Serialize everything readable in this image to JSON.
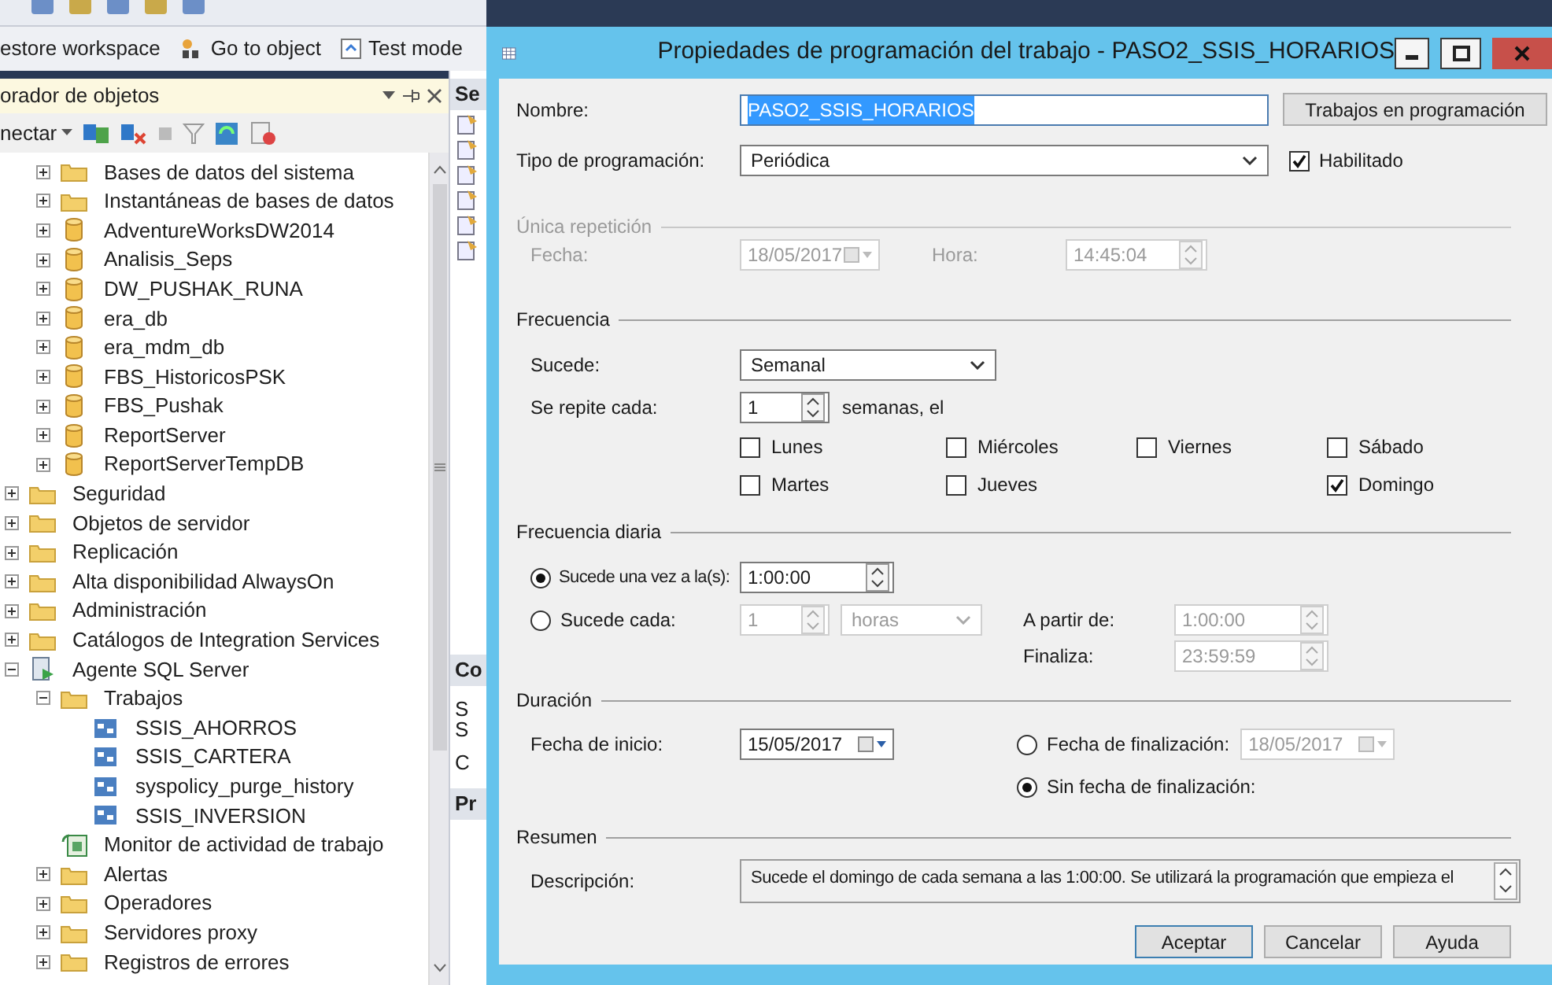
{
  "toolbar": {
    "items": [
      {
        "label": "estore workspace",
        "kind": "plain"
      },
      {
        "label": "Go to object",
        "kind": "binoculars"
      },
      {
        "label": "Test mode",
        "kind": "test"
      }
    ]
  },
  "object_explorer": {
    "title": "orador de objetos",
    "connect_label": "nectar",
    "partial_branch": [
      {
        "label": "Bases de datos del sistema",
        "kind": "folder",
        "expanded": false
      },
      {
        "label": "Instantáneas de bases de datos",
        "kind": "folder",
        "expanded": false
      },
      {
        "label": "AdventureWorksDW2014",
        "kind": "database",
        "expanded": false
      },
      {
        "label": "Analisis_Seps",
        "kind": "database",
        "expanded": false
      },
      {
        "label": "DW_PUSHAK_RUNA",
        "kind": "database",
        "expanded": false
      },
      {
        "label": "era_db",
        "kind": "database",
        "expanded": false
      },
      {
        "label": "era_mdm_db",
        "kind": "database",
        "expanded": false
      },
      {
        "label": "FBS_HistoricosPSK",
        "kind": "database",
        "expanded": false
      },
      {
        "label": "FBS_Pushak",
        "kind": "database",
        "expanded": false
      },
      {
        "label": "ReportServer",
        "kind": "database",
        "expanded": false
      },
      {
        "label": "ReportServerTempDB",
        "kind": "database",
        "expanded": false
      }
    ],
    "tree": [
      {
        "label": "Seguridad",
        "kind": "folder",
        "expanded": false
      },
      {
        "label": "Objetos de servidor",
        "kind": "folder",
        "expanded": false
      },
      {
        "label": "Replicación",
        "kind": "folder",
        "expanded": false
      },
      {
        "label": "Alta disponibilidad AlwaysOn",
        "kind": "folder",
        "expanded": false
      },
      {
        "label": "Administración",
        "kind": "folder",
        "expanded": false
      },
      {
        "label": "Catálogos de Integration Services",
        "kind": "folder",
        "expanded": false
      },
      {
        "label": "Agente SQL Server",
        "kind": "agent",
        "expanded": true,
        "children": [
          {
            "label": "Trabajos",
            "kind": "folder",
            "expanded": true,
            "children": [
              {
                "label": "SSIS_AHORROS",
                "kind": "job"
              },
              {
                "label": "SSIS_CARTERA",
                "kind": "job"
              },
              {
                "label": "syspolicy_purge_history",
                "kind": "job"
              },
              {
                "label": "SSIS_INVERSION",
                "kind": "job"
              }
            ]
          },
          {
            "label": "Monitor de actividad de trabajo",
            "kind": "monitor"
          },
          {
            "label": "Alertas",
            "kind": "folder",
            "expanded": false
          },
          {
            "label": "Operadores",
            "kind": "folder",
            "expanded": false
          },
          {
            "label": "Servidores proxy",
            "kind": "folder",
            "expanded": false
          },
          {
            "label": "Registros de errores",
            "kind": "folder",
            "expanded": false
          }
        ]
      }
    ]
  },
  "side_panel": {
    "sections": [
      {
        "heading": "Se"
      },
      {
        "heading": "Co",
        "lines": [
          "S",
          "S",
          "C"
        ]
      },
      {
        "heading": "Pr"
      }
    ]
  },
  "dialog": {
    "title": "Propiedades de programación del trabajo - PASO2_SSIS_HORARIOS",
    "name": {
      "label": "Nombre:",
      "value": "PASO2_SSIS_HORARIOS",
      "selected": true
    },
    "jobs_button": "Trabajos en programación",
    "schedule_type": {
      "label": "Tipo de programación:",
      "value": "Periódica"
    },
    "enabled": {
      "label": "Habilitado",
      "checked": true
    },
    "one_time": {
      "title": "Única repetición",
      "disabled": true,
      "date_label": "Fecha:",
      "date": "18/05/2017",
      "time_label": "Hora:",
      "time": "14:45:04"
    },
    "frequency": {
      "title": "Frecuencia",
      "occurs_label": "Sucede:",
      "occurs": "Semanal",
      "recurs_label": "Se repite cada:",
      "recurs_value": "1",
      "recurs_unit": "semanas, el",
      "day_columns": [
        [
          {
            "label": "Lunes",
            "checked": false
          },
          {
            "label": "Martes",
            "checked": false
          }
        ],
        [
          {
            "label": "Miércoles",
            "checked": false
          },
          {
            "label": "Jueves",
            "checked": false
          }
        ],
        [
          {
            "label": "Viernes",
            "checked": false
          }
        ],
        [
          {
            "label": "Sábado",
            "checked": false
          },
          {
            "label": "Domingo",
            "checked": true
          }
        ]
      ]
    },
    "daily": {
      "title": "Frecuencia diaria",
      "options": [
        {
          "label": "Sucede una vez a la(s):",
          "selected": true,
          "time": "1:00:00"
        },
        {
          "label": "Sucede cada:",
          "selected": false,
          "interval": "1",
          "unit": "horas"
        }
      ],
      "start_label": "A partir de:",
      "start": "1:00:00",
      "end_label": "Finaliza:",
      "end": "23:59:59"
    },
    "duration": {
      "title": "Duración",
      "start_label": "Fecha de inicio:",
      "start": "15/05/2017",
      "end_options": [
        {
          "label": "Fecha de finalización:",
          "selected": false,
          "date": "18/05/2017"
        },
        {
          "label": "Sin fecha de finalización:",
          "selected": true
        }
      ]
    },
    "summary": {
      "title": "Resumen",
      "label": "Descripción:",
      "text": "Sucede el domingo de cada semana a las 1:00:00. Se utilizará la programación que empieza el"
    },
    "buttons": [
      {
        "label": "Aceptar",
        "default": true
      },
      {
        "label": "Cancelar",
        "default": false
      },
      {
        "label": "Ayuda",
        "default": false
      }
    ]
  }
}
